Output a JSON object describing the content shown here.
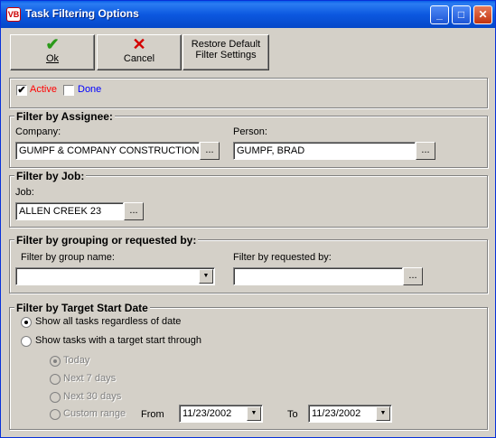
{
  "window": {
    "title": "Task Filtering Options",
    "app_icon": "VB",
    "controls": {
      "minimize": "_",
      "maximize": "□",
      "close": "✕"
    }
  },
  "toolbar": {
    "ok_icon": "✔",
    "ok_label": "Ok",
    "cancel_icon": "✕",
    "cancel_label": "Cancel",
    "restore_label_line1": "Restore Default",
    "restore_label_line2": "Filter Settings",
    "colors": {
      "ok_icon": "#2a9a1a",
      "cancel_icon": "#d40000"
    }
  },
  "status": {
    "active_label": "Active",
    "active_checked": "✔",
    "done_label": "Done",
    "colors": {
      "active": "#ff0000",
      "done": "#0000ff"
    }
  },
  "assignee": {
    "legend": "Filter by Assignee:",
    "company_label": "Company:",
    "company_value": "GUMPF & COMPANY CONSTRUCTION",
    "person_label": "Person:",
    "person_value": "GUMPF, BRAD",
    "browse_label": "..."
  },
  "job": {
    "legend": "Filter by Job:",
    "job_label": "Job:",
    "job_value": "ALLEN CREEK 23",
    "browse_label": "..."
  },
  "grouping": {
    "legend": "Filter by grouping or requested by:",
    "group_label": "Filter by group name:",
    "group_value": "",
    "requested_label": "Filter by requested by:",
    "requested_value": "",
    "browse_label": "..."
  },
  "target_date": {
    "legend": "Filter by Target Start Date",
    "option_all": "Show all tasks regardless of date",
    "option_through": "Show tasks with a target start through",
    "today": "Today",
    "next7": "Next 7 days",
    "next30": "Next 30 days",
    "custom": "Custom range",
    "from_label": "From",
    "from_value": "11/23/2002",
    "to_label": "To",
    "to_value": "11/23/2002",
    "dropdown_arrow": "▼"
  }
}
